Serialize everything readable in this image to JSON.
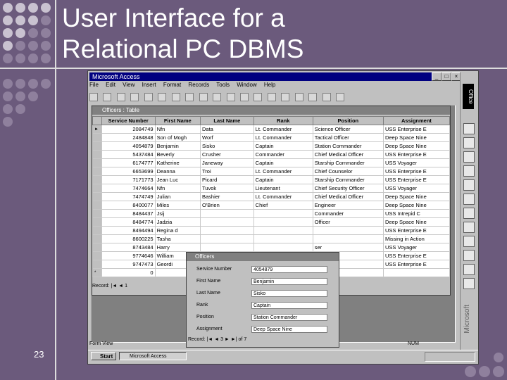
{
  "slide": {
    "title_line1": "User Interface for a",
    "title_line2": "Relational PC DBMS",
    "page_number": "23"
  },
  "app": {
    "title": "Microsoft Access",
    "menu": [
      "File",
      "Edit",
      "View",
      "Insert",
      "Format",
      "Records",
      "Tools",
      "Window",
      "Help"
    ],
    "status_text": "Form View",
    "status_num": "NUM",
    "office_label": "Office",
    "microsoft_label": "Microsoft",
    "start_label": "Start",
    "taskbar_item": "Microsoft Access"
  },
  "table": {
    "title": "Officers : Table",
    "columns": [
      "Service Number",
      "First Name",
      "Last Name",
      "Rank",
      "Position",
      "Assignment"
    ],
    "rows": [
      [
        "2084749",
        "Nfn",
        "Data",
        "Lt. Commander",
        "Science Officer",
        "USS Enterprise E"
      ],
      [
        "2484848",
        "Son of Mogh",
        "Worf",
        "Lt. Commander",
        "Tactical Officer",
        "Deep Space Nine"
      ],
      [
        "4054879",
        "Benjamin",
        "Sisko",
        "Captain",
        "Station Commander",
        "Deep Space Nine"
      ],
      [
        "5437484",
        "Beverly",
        "Crusher",
        "Commander",
        "Chief Medical Officer",
        "USS Enterprise E"
      ],
      [
        "6174777",
        "Katherine",
        "Janeway",
        "Captain",
        "Starship Commander",
        "USS Voyager"
      ],
      [
        "6653699",
        "Deanna",
        "Troi",
        "Lt. Commander",
        "Chief Counselor",
        "USS Enterprise E"
      ],
      [
        "7171773",
        "Jean Luc",
        "Picard",
        "Captain",
        "Starship Commander",
        "USS Enterprise E"
      ],
      [
        "7474664",
        "Nfn",
        "Tuvok",
        "Lieutenant",
        "Chief Security Officer",
        "USS Voyager"
      ],
      [
        "7474749",
        "Julian",
        "Bashier",
        "Lt. Commander",
        "Chief Medical Officer",
        "Deep Space Nine"
      ],
      [
        "8400077",
        "Miles",
        "O'Brien",
        "Chief",
        "Engineer",
        "Deep Space Nine"
      ],
      [
        "8484437",
        "Jsij",
        "",
        "",
        "Commander",
        "USS Intrepid C"
      ],
      [
        "8484774",
        "Jadzia",
        "",
        "",
        "Officer",
        "Deep Space Nine"
      ],
      [
        "8494494",
        "Regina d",
        "",
        "",
        "",
        "USS Enterprise E"
      ],
      [
        "8600225",
        "Tasha",
        "",
        "",
        "",
        "Missing in Action"
      ],
      [
        "8743484",
        "Harry",
        "",
        "",
        "ser",
        "USS Voyager"
      ],
      [
        "9774646",
        "William",
        "",
        "",
        "cer",
        "USS Enterprise E"
      ],
      [
        "9747473",
        "Geordi",
        "",
        "",
        "ineer",
        "USS Enterprise E"
      ],
      [
        "0",
        "",
        "",
        "",
        "",
        ""
      ]
    ],
    "record_label": "Record:",
    "record_value": "1"
  },
  "form": {
    "title": "Officers",
    "fields": [
      {
        "label": "Service Number",
        "value": "4054879"
      },
      {
        "label": "First Name",
        "value": "Benjamin"
      },
      {
        "label": "Last Name",
        "value": "Sisko"
      },
      {
        "label": "Rank",
        "value": "Captain"
      },
      {
        "label": "Position",
        "value": "Station Commander"
      },
      {
        "label": "Assignment",
        "value": "Deep Space Nine"
      }
    ],
    "record_label": "Record:",
    "record_value": "3",
    "record_of": "of",
    "record_total": "7"
  },
  "colors": {
    "slide_bg": "#6b5a7c",
    "titlebar": "#000080",
    "window": "#c0c0c0"
  }
}
